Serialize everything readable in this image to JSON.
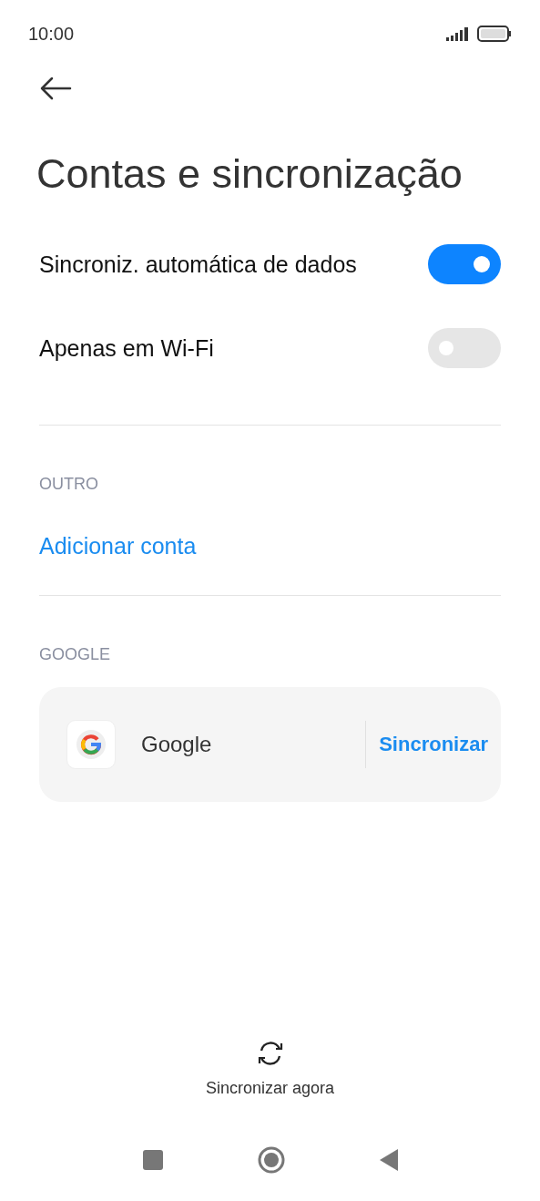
{
  "status_bar": {
    "time": "10:00"
  },
  "title": "Contas e sincronização",
  "toggles": [
    {
      "label": "Sincroniz. automática de dados",
      "on": true
    },
    {
      "label": "Apenas em Wi-Fi",
      "on": false
    }
  ],
  "sections": [
    {
      "header": "OUTRO",
      "link": "Adicionar conta"
    },
    {
      "header": "GOOGLE",
      "account": {
        "name": "Google",
        "action": "Sincronizar"
      }
    }
  ],
  "sync_now": {
    "label": "Sincronizar agora"
  }
}
